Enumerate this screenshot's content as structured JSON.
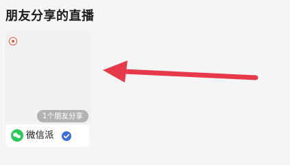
{
  "section": {
    "title": "朋友分享的直播"
  },
  "card": {
    "share_badge": "1个朋友分享",
    "account_name": "微信派"
  },
  "colors": {
    "live_dot": "#e4573d",
    "wechat_green": "#2bc85a",
    "verified_blue": "#3c6ee0",
    "arrow_red": "#e63a4b"
  },
  "icons": [
    "live-indicator-icon",
    "wechat-icon",
    "verified-icon",
    "arrow-annotation"
  ]
}
